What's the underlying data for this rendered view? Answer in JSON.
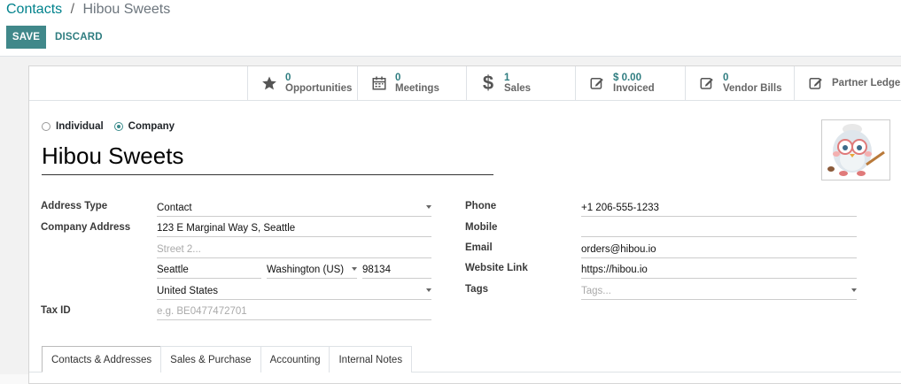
{
  "breadcrumb": {
    "parent": "Contacts",
    "separator": "/",
    "current": "Hibou Sweets"
  },
  "actions": {
    "save": "SAVE",
    "discard": "DISCARD"
  },
  "stats": [
    {
      "icon": "star-icon",
      "value": "0",
      "label": "Opportunities"
    },
    {
      "icon": "calendar-icon",
      "value": "0",
      "label": "Meetings"
    },
    {
      "icon": "dollar-icon",
      "value": "1",
      "label": "Sales"
    },
    {
      "icon": "edit-icon",
      "value": "$ 0.00",
      "label": "Invoiced"
    },
    {
      "icon": "edit-icon",
      "value": "0",
      "label": "Vendor Bills"
    },
    {
      "icon": "edit-icon",
      "value": "",
      "label": "Partner Ledger"
    }
  ],
  "company_type": {
    "individual": "Individual",
    "company": "Company",
    "selected": "company"
  },
  "name": "Hibou Sweets",
  "left": {
    "address_type_label": "Address Type",
    "address_type_value": "Contact",
    "company_address_label": "Company Address",
    "street": "123 E Marginal Way S, Seattle",
    "street2_placeholder": "Street 2...",
    "city": "Seattle",
    "state": "Washington (US)",
    "zip": "98134",
    "country": "United States",
    "tax_id_label": "Tax ID",
    "tax_id_placeholder": "e.g. BE0477472701"
  },
  "right": {
    "phone_label": "Phone",
    "phone_value": "+1 206-555-1233",
    "mobile_label": "Mobile",
    "mobile_value": "",
    "email_label": "Email",
    "email_value": "orders@hibou.io",
    "website_label": "Website Link",
    "website_value": "https://hibou.io",
    "tags_label": "Tags",
    "tags_placeholder": "Tags..."
  },
  "tabs": [
    "Contacts & Addresses",
    "Sales & Purchase",
    "Accounting",
    "Internal Notes"
  ],
  "colors": {
    "accent": "#3a8b8b",
    "link": "#2f7d80"
  }
}
